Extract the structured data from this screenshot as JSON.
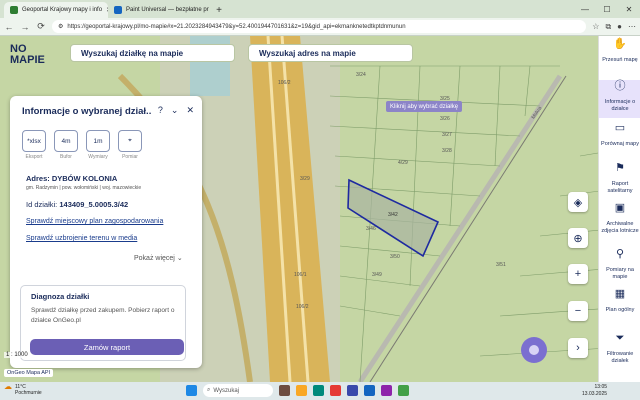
{
  "browser": {
    "tabs": [
      {
        "title": "Geoportal Krajowy mapy i info",
        "active": true,
        "color": "#2e7d32"
      },
      {
        "title": "Paint Universal — bezpłatne pr",
        "active": false,
        "color": "#1565c0"
      }
    ],
    "url": "https://geoportal-krajowy.pl/mo-mapie#x=21.2023284943479&y=52.4001944701631&z=19&gid_api=ekmanknetedtkptdnmunun",
    "new_tab": "+"
  },
  "app": {
    "logo_line1": "NO",
    "logo_line2": "MAPIE",
    "search_plot_label": "Wyszukaj działkę na mapie",
    "search_address_label": "Wyszukaj adres na mapie",
    "tooltip": "Kliknij aby wybrać działkę"
  },
  "panel": {
    "title": "Informacje o wybranej dział...",
    "tools": [
      {
        "icon": "*xlsx",
        "label": "Eksport"
      },
      {
        "icon": "4m",
        "label": "Bufor"
      },
      {
        "icon": "1m",
        "label": "Wymiary"
      },
      {
        "icon": "⌖",
        "label": "Pomiar"
      }
    ],
    "address": "Adres: DYBÓW KOLONIA",
    "address_detail": "gm. Radzymin | pow. wołomiński | woj. mazowieckie",
    "id_label": "Id działki:",
    "id_value": "143409_5.0005.3/42",
    "link_plan": "Sprawdź miejscowy plan zagospodarowania",
    "link_utilities": "Sprawdź uzbrojenie terenu w media",
    "show_more": "Pokaż więcej",
    "diagnosis_title": "Diagnoza działki",
    "diagnosis_text": "Sprawdź działkę przed zakupem. Pobierz raport o działce OnGeo.pl",
    "order_button": "Zamów raport"
  },
  "map": {
    "scale": "1 : 1000",
    "api_label": "OnGeo Mapa API",
    "parcel_labels": [
      "106/2",
      "3/24",
      "3/25",
      "3/26",
      "3/27",
      "3/28",
      "3/29",
      "4/29",
      "3/42",
      "3/46",
      "3/49",
      "3/50",
      "3/51",
      "106/1",
      "106/2"
    ],
    "road_label": "Mokra"
  },
  "sidebar": {
    "items": [
      {
        "icon": "✋",
        "label": "Przesuń mapę",
        "active": false
      },
      {
        "icon": "ⓘ",
        "label": "Informacje o działce",
        "active": true
      },
      {
        "icon": "▭",
        "label": "Porównaj mapy",
        "active": false
      },
      {
        "icon": "⚑",
        "label": "Raport satelitarny",
        "active": false
      },
      {
        "icon": "▣",
        "label": "Archiwalne zdjęcia lotnicze",
        "active": false
      },
      {
        "icon": "⚲",
        "label": "Pomiary na mapie",
        "active": false
      },
      {
        "icon": "▦",
        "label": "Plan ogólny",
        "active": false
      },
      {
        "icon": "⏷",
        "label": "Filtrowanie działek",
        "active": false
      }
    ]
  },
  "taskbar": {
    "weather_temp": "11°C",
    "weather_desc": "Pochmurnie",
    "search_placeholder": "Wyszukaj",
    "time": "13:05",
    "date": "13.03.2025"
  }
}
